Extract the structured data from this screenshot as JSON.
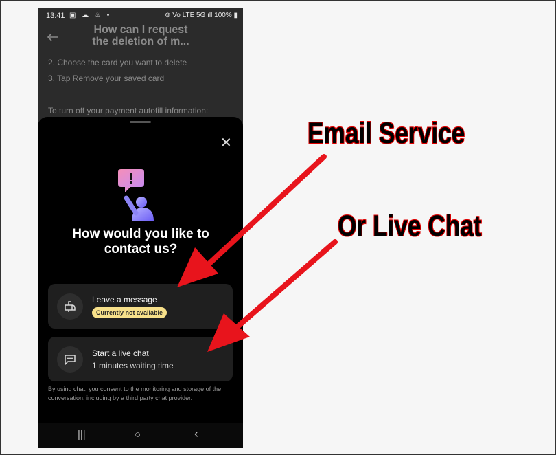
{
  "status": {
    "time": "13:41",
    "icons_left": "▣ ☁ ♨ •",
    "icons_right": "⊚ Vo LTE 5G ıll 100% ▮"
  },
  "header": {
    "back_icon": "back-arrow-icon",
    "title": "How can I request the deletion of m..."
  },
  "background_text": {
    "line1": "2. Choose the card you want to delete",
    "line2": "3. Tap Remove your saved card",
    "line3": "To turn off your payment autofill information:"
  },
  "sheet": {
    "heading": "How would you like to contact us?",
    "options": [
      {
        "title": "Leave a message",
        "badge": "Currently not available",
        "icon": "mailbox-icon"
      },
      {
        "title": "Start a live chat",
        "subtitle": "1 minutes waiting time",
        "icon": "chat-bubble-icon"
      }
    ],
    "consent": "By using chat, you consent to the monitoring and storage of the conversation, including by a third party chat provider."
  },
  "navbar": {
    "recents": "|||",
    "home": "○",
    "back": "‹"
  },
  "annotations": {
    "label1": "Email Service",
    "label2": "Or Live Chat",
    "arrow_color": "#e8141c"
  },
  "colors": {
    "badge": "#f7e08a",
    "sheet_bg": "#000000",
    "card_bg": "#1f1f1f"
  }
}
